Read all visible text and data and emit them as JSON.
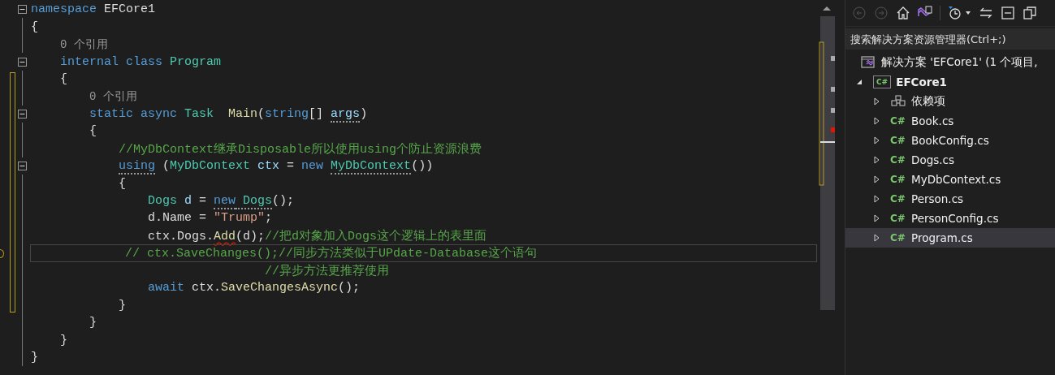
{
  "editor": {
    "lines": [
      {
        "kind": "code",
        "foldable": true,
        "changed": false,
        "current": false,
        "tokens": [
          {
            "kind": "keyword",
            "text": "namespace"
          },
          {
            "kind": "plain",
            "text": " EFCore1"
          }
        ]
      },
      {
        "kind": "code",
        "foldable": false,
        "changed": false,
        "current": false,
        "tokens": [
          {
            "kind": "plain",
            "text": "{"
          }
        ],
        "children": [
          {
            "kind": "lens",
            "foldable": false,
            "changed": false,
            "current": false,
            "tokens": [
              {
                "kind": "lens",
                "text": "0 个引用"
              }
            ]
          },
          {
            "kind": "code",
            "foldable": true,
            "changed": false,
            "current": false,
            "tokens": [
              {
                "kind": "keyword",
                "text": "internal class "
              },
              {
                "kind": "type",
                "text": "Program"
              }
            ]
          },
          {
            "kind": "code",
            "foldable": false,
            "changed": true,
            "current": false,
            "tokens": [
              {
                "kind": "plain",
                "text": "{"
              }
            ],
            "children": [
              {
                "kind": "lens",
                "foldable": false,
                "changed": true,
                "current": false,
                "tokens": [
                  {
                    "kind": "lens",
                    "text": "0 个引用"
                  }
                ]
              },
              {
                "kind": "code",
                "foldable": true,
                "changed": true,
                "current": false,
                "tokens": [
                  {
                    "kind": "keyword",
                    "text": "static async "
                  },
                  {
                    "kind": "type",
                    "text": "Task  "
                  },
                  {
                    "kind": "method",
                    "text": "Main"
                  },
                  {
                    "kind": "plain",
                    "text": "("
                  },
                  {
                    "kind": "keyword",
                    "text": "string"
                  },
                  {
                    "kind": "plain",
                    "text": "[] "
                  },
                  {
                    "kind": "variable",
                    "text": "args",
                    "hint": true
                  },
                  {
                    "kind": "plain",
                    "text": ")"
                  }
                ]
              },
              {
                "kind": "code",
                "foldable": false,
                "changed": true,
                "current": false,
                "tokens": [
                  {
                    "kind": "plain",
                    "text": "{"
                  }
                ],
                "children": [
                  {
                    "kind": "code",
                    "foldable": false,
                    "changed": true,
                    "current": false,
                    "tokens": [
                      {
                        "kind": "comment",
                        "text": "//MyDbContext继承Disposable所以使用using个防止资源浪费"
                      }
                    ]
                  },
                  {
                    "kind": "code",
                    "foldable": true,
                    "changed": true,
                    "current": false,
                    "tokens": [
                      {
                        "kind": "keyword",
                        "text": "using",
                        "hint": true
                      },
                      {
                        "kind": "plain",
                        "text": " ("
                      },
                      {
                        "kind": "type",
                        "text": "MyDbContext"
                      },
                      {
                        "kind": "variable",
                        "text": " ctx"
                      },
                      {
                        "kind": "plain",
                        "text": " = "
                      },
                      {
                        "kind": "keyword",
                        "text": "new "
                      },
                      {
                        "kind": "type",
                        "text": "MyDbContext",
                        "hint": true
                      },
                      {
                        "kind": "plain",
                        "text": "())"
                      }
                    ]
                  },
                  {
                    "kind": "code",
                    "foldable": false,
                    "changed": true,
                    "current": false,
                    "tokens": [
                      {
                        "kind": "plain",
                        "text": "{"
                      }
                    ],
                    "children": [
                      {
                        "kind": "code",
                        "foldable": false,
                        "changed": true,
                        "current": false,
                        "tokens": [
                          {
                            "kind": "type",
                            "text": "Dogs"
                          },
                          {
                            "kind": "variable",
                            "text": " d"
                          },
                          {
                            "kind": "plain",
                            "text": " = "
                          },
                          {
                            "kind": "keyword",
                            "text": "new",
                            "hint": true
                          },
                          {
                            "kind": "type",
                            "text": " Dogs",
                            "hint": true
                          },
                          {
                            "kind": "plain",
                            "text": "();"
                          }
                        ]
                      },
                      {
                        "kind": "code",
                        "foldable": false,
                        "changed": true,
                        "current": false,
                        "tokens": [
                          {
                            "kind": "plain",
                            "text": "d.Name = "
                          },
                          {
                            "kind": "string",
                            "text": "\"Trump\""
                          },
                          {
                            "kind": "plain",
                            "text": ";"
                          }
                        ]
                      },
                      {
                        "kind": "code",
                        "foldable": false,
                        "changed": true,
                        "current": false,
                        "tokens": [
                          {
                            "kind": "plain",
                            "text": "ctx.Dogs."
                          },
                          {
                            "kind": "method",
                            "text": "Add",
                            "error": true
                          },
                          {
                            "kind": "plain",
                            "text": "(d);"
                          },
                          {
                            "kind": "comment",
                            "text": "//把d对象加入Dogs这个逻辑上的表里面"
                          }
                        ]
                      },
                      {
                        "kind": "outdented",
                        "foldable": false,
                        "changed": true,
                        "current": true,
                        "tokens": [
                          {
                            "kind": "comment",
                            "text": "// ctx.SaveChanges();//同步方法类似于UPdate-Database这个语句"
                          }
                        ]
                      },
                      {
                        "kind": "continuation",
                        "foldable": false,
                        "changed": true,
                        "current": false,
                        "tokens": [
                          {
                            "kind": "comment",
                            "text": "//异步方法更推荐使用"
                          }
                        ]
                      },
                      {
                        "kind": "code",
                        "foldable": false,
                        "changed": true,
                        "current": false,
                        "tokens": [
                          {
                            "kind": "keyword",
                            "text": "await"
                          },
                          {
                            "kind": "plain",
                            "text": " ctx."
                          },
                          {
                            "kind": "method",
                            "text": "SaveChangesAsync"
                          },
                          {
                            "kind": "plain",
                            "text": "();"
                          }
                        ]
                      }
                    ]
                  },
                  {
                    "kind": "code",
                    "foldable": false,
                    "changed": true,
                    "current": false,
                    "tokens": [
                      {
                        "kind": "plain",
                        "text": "}"
                      }
                    ]
                  }
                ]
              },
              {
                "kind": "code",
                "foldable": false,
                "changed": false,
                "current": false,
                "tokens": [
                  {
                    "kind": "plain",
                    "text": "}"
                  }
                ]
              }
            ]
          },
          {
            "kind": "code",
            "foldable": false,
            "changed": false,
            "current": false,
            "tokens": [
              {
                "kind": "plain",
                "text": "}"
              }
            ]
          }
        ]
      },
      {
        "kind": "code",
        "foldable": false,
        "changed": false,
        "current": false,
        "tokens": [
          {
            "kind": "plain",
            "text": "}"
          }
        ]
      }
    ]
  },
  "solution_explorer": {
    "search": {
      "placeholder": "搜索解决方案资源管理器(Ctrl+;)"
    },
    "solution": {
      "label": "解决方案 'EFCore1' (1 个项目,",
      "selected": false
    },
    "project": {
      "label": "EFCore1",
      "icon_text": "C#",
      "expanded": true,
      "selected": false,
      "children": [
        {
          "kind": "dependencies",
          "label": "依赖项",
          "expanded": false,
          "selected": false
        },
        {
          "kind": "cs",
          "icon_text": "C#",
          "label": "Book.cs",
          "expanded": false,
          "selected": false
        },
        {
          "kind": "cs",
          "icon_text": "C#",
          "label": "BookConfig.cs",
          "expanded": false,
          "selected": false
        },
        {
          "kind": "cs",
          "icon_text": "C#",
          "label": "Dogs.cs",
          "expanded": false,
          "selected": false
        },
        {
          "kind": "cs",
          "icon_text": "C#",
          "label": "MyDbContext.cs",
          "expanded": false,
          "selected": false
        },
        {
          "kind": "cs",
          "icon_text": "C#",
          "label": "Person.cs",
          "expanded": false,
          "selected": false
        },
        {
          "kind": "cs",
          "icon_text": "C#",
          "label": "PersonConfig.cs",
          "expanded": false,
          "selected": false
        },
        {
          "kind": "cs",
          "icon_text": "C#",
          "label": "Program.cs",
          "expanded": false,
          "selected": true
        }
      ]
    }
  }
}
